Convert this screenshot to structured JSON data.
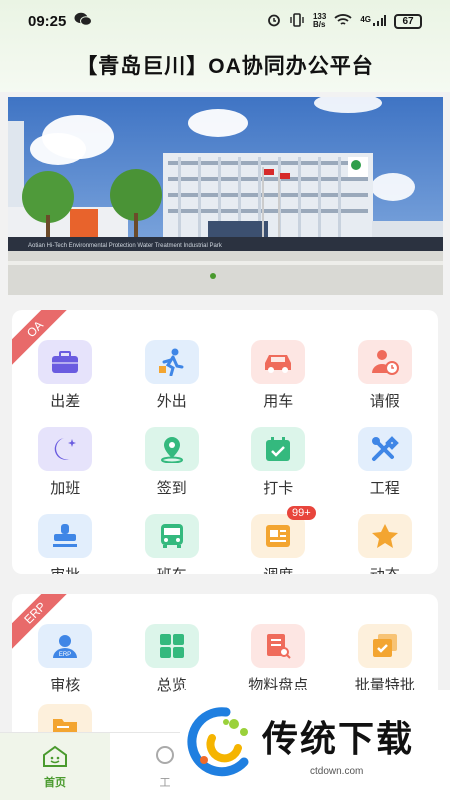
{
  "status_bar": {
    "time": "09:25",
    "net_speed_value": "133",
    "net_speed_unit": "B/s",
    "signal": "4G",
    "battery": "67"
  },
  "header": {
    "title": "【青岛巨川】OA协同办公平台"
  },
  "banner": {
    "sign_text": "Aotian Hi-Tech Environmental Protection Water Treatment Industrial Park",
    "image_desc": "photo of office building with flags"
  },
  "oa_section": {
    "ribbon": "OA",
    "items": [
      {
        "label": "出差",
        "icon": "suitcase-icon",
        "bg": "#e6e3fb",
        "color": "#6a5ce0"
      },
      {
        "label": "外出",
        "icon": "walking-icon",
        "bg": "#e2eefc",
        "color": "#3f86e6"
      },
      {
        "label": "用车",
        "icon": "car-icon",
        "bg": "#fde6e3",
        "color": "#ef6b5b"
      },
      {
        "label": "请假",
        "icon": "leave-icon",
        "bg": "#fde6e3",
        "color": "#ef6b5b"
      },
      {
        "label": "加班",
        "icon": "moon-icon",
        "bg": "#e6e3fb",
        "color": "#6a5ce0"
      },
      {
        "label": "签到",
        "icon": "location-icon",
        "bg": "#dcf5ea",
        "color": "#34b97e"
      },
      {
        "label": "打卡",
        "icon": "calendar-check-icon",
        "bg": "#dcf5ea",
        "color": "#34b97e"
      },
      {
        "label": "工程",
        "icon": "tools-icon",
        "bg": "#e2eefc",
        "color": "#3f86e6"
      },
      {
        "label": "审批",
        "icon": "stamp-icon",
        "bg": "#e2eefc",
        "color": "#3f86e6"
      },
      {
        "label": "班车",
        "icon": "bus-icon",
        "bg": "#dcf5ea",
        "color": "#34b97e"
      },
      {
        "label": "调度",
        "icon": "dispatch-icon",
        "bg": "#fdf0dc",
        "color": "#f3a531",
        "badge": "99+"
      },
      {
        "label": "动态",
        "icon": "star-icon",
        "bg": "#fdf0dc",
        "color": "#f3a531"
      }
    ]
  },
  "erp_section": {
    "ribbon": "ERP",
    "items": [
      {
        "label": "审核",
        "icon": "erp-shield-icon",
        "bg": "#e2eefc",
        "color": "#3f86e6"
      },
      {
        "label": "总览",
        "icon": "grid-icon",
        "bg": "#dcf5ea",
        "color": "#34b97e"
      },
      {
        "label": "物料盘点",
        "icon": "inventory-icon",
        "bg": "#fde6e3",
        "color": "#ef6b5b"
      },
      {
        "label": "批量特批",
        "icon": "batch-approve-icon",
        "bg": "#fdf0dc",
        "color": "#f3a531"
      }
    ]
  },
  "bottom_nav": {
    "home_label": "首页",
    "work_label": "工"
  },
  "watermark": {
    "text": "传统下载",
    "url": "ctdown.com"
  }
}
